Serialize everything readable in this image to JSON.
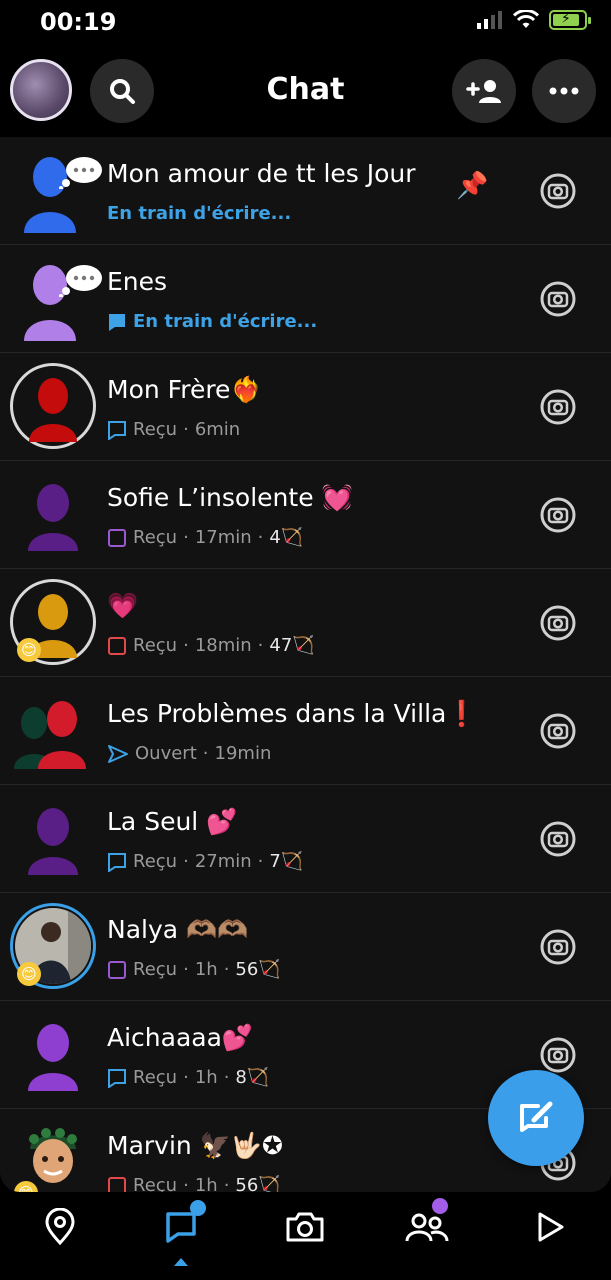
{
  "status": {
    "time": "00:19"
  },
  "header": {
    "title": "Chat"
  },
  "chats": [
    {
      "name": "Mon amour de tt les Jour",
      "status": "En train d'écrire..."
    },
    {
      "name": "Enes",
      "status": "En train d'écrire..."
    },
    {
      "name": "Mon Frère❤️‍🔥",
      "status": "Reçu",
      "time": "6min"
    },
    {
      "name": "Sofie L’insolente 💓",
      "status": "Reçu",
      "time": "17min",
      "streak": "4🏹"
    },
    {
      "name": "💗",
      "status": "Reçu",
      "time": "18min",
      "streak": "47🏹"
    },
    {
      "name": "Les Problèmes dans la Villa❗",
      "status": "Ouvert",
      "time": "19min"
    },
    {
      "name": "La Seul 💕",
      "status": "Reçu",
      "time": "27min",
      "streak": "7🏹"
    },
    {
      "name": "Nalya 🫶🏽🫶🏽",
      "status": "Reçu",
      "time": "1h",
      "streak": "56🏹"
    },
    {
      "name": "Aichaaaa💕",
      "status": "Reçu",
      "time": "1h",
      "streak": "8🏹"
    },
    {
      "name": "Marvin 🦅🤟🏻✪",
      "status": "Reçu",
      "time": "1h",
      "streak": "56🏹"
    }
  ],
  "colors": {
    "accent_blue": "#3a9eea",
    "chat_purple": "#9b59d0",
    "snap_red": "#e04a4a",
    "background": "#121212"
  },
  "bottom_nav": {
    "items": [
      "map-icon",
      "chat-icon",
      "camera-icon",
      "stories-icon",
      "spotlight-icon"
    ],
    "active": "chat-icon"
  }
}
